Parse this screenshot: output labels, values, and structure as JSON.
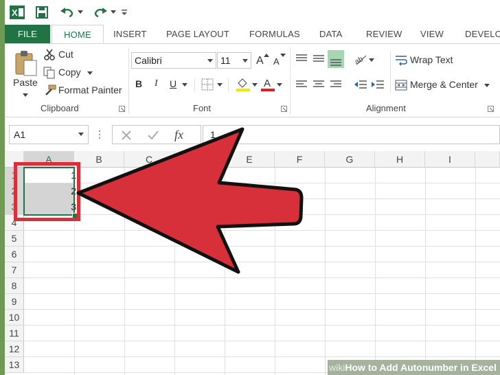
{
  "qat": {
    "icons": [
      "excel-logo-icon",
      "save-icon",
      "undo-icon",
      "redo-icon",
      "customize-icon"
    ]
  },
  "tabs": [
    "FILE",
    "HOME",
    "INSERT",
    "PAGE LAYOUT",
    "FORMULAS",
    "DATA",
    "REVIEW",
    "VIEW",
    "DEVELO"
  ],
  "clipboard": {
    "paste": "Paste",
    "cut": "Cut",
    "copy": "Copy",
    "format_painter": "Format Painter",
    "group": "Clipboard"
  },
  "font": {
    "name": "Calibri",
    "size": "11",
    "grow": "A",
    "shrink": "A",
    "bold": "B",
    "italic": "I",
    "underline": "U",
    "group": "Font"
  },
  "alignment": {
    "wrap": "Wrap Text",
    "merge": "Merge & Center",
    "group": "Alignment"
  },
  "formula_bar": {
    "name_box": "A1",
    "fx": "fx",
    "value": "1"
  },
  "columns": [
    "A",
    "B",
    "C",
    "D",
    "E",
    "F",
    "G",
    "H",
    "I"
  ],
  "rows": [
    "1",
    "2",
    "3",
    "4",
    "5",
    "6",
    "7",
    "8",
    "9",
    "10",
    "11",
    "12",
    "13"
  ],
  "cells": {
    "A1": "1",
    "A2": "2",
    "A3": "3"
  },
  "colors": {
    "excel_green": "#217346",
    "arrow_red": "#d8303b",
    "highlight_red": "#d8303b"
  },
  "watermark": {
    "brand": "wiki",
    "title": "How to Add Autonumber in Excel"
  }
}
